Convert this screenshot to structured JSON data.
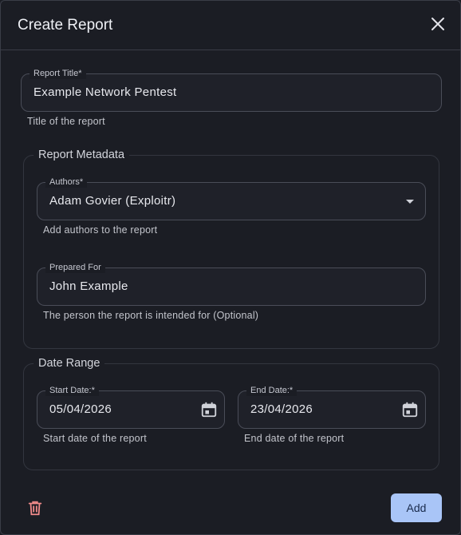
{
  "dialog": {
    "title": "Create Report"
  },
  "report_title": {
    "label": "Report Title*",
    "value": "Example Network Pentest",
    "helper": "Title of the report"
  },
  "metadata": {
    "legend": "Report Metadata",
    "authors": {
      "label": "Authors*",
      "value": "Adam Govier (Exploitr)",
      "helper": "Add authors to the report"
    },
    "prepared_for": {
      "label": "Prepared For",
      "value": "John Example",
      "helper": "The person the report is intended for (Optional)"
    }
  },
  "date_range": {
    "legend": "Date Range",
    "start": {
      "label": "Start Date:*",
      "value": "05/04/2026",
      "helper": "Start date of the report"
    },
    "end": {
      "label": "End Date:*",
      "value": "23/04/2026",
      "helper": "End date of the report"
    }
  },
  "actions": {
    "add_label": "Add"
  },
  "icons": {
    "close": "close-icon",
    "dropdown": "chevron-down-icon",
    "calendar": "calendar-icon",
    "delete": "trash-icon"
  },
  "colors": {
    "background": "#1b1d24",
    "accent_button": "#a9c5f7",
    "delete_icon": "#f08a8a"
  }
}
